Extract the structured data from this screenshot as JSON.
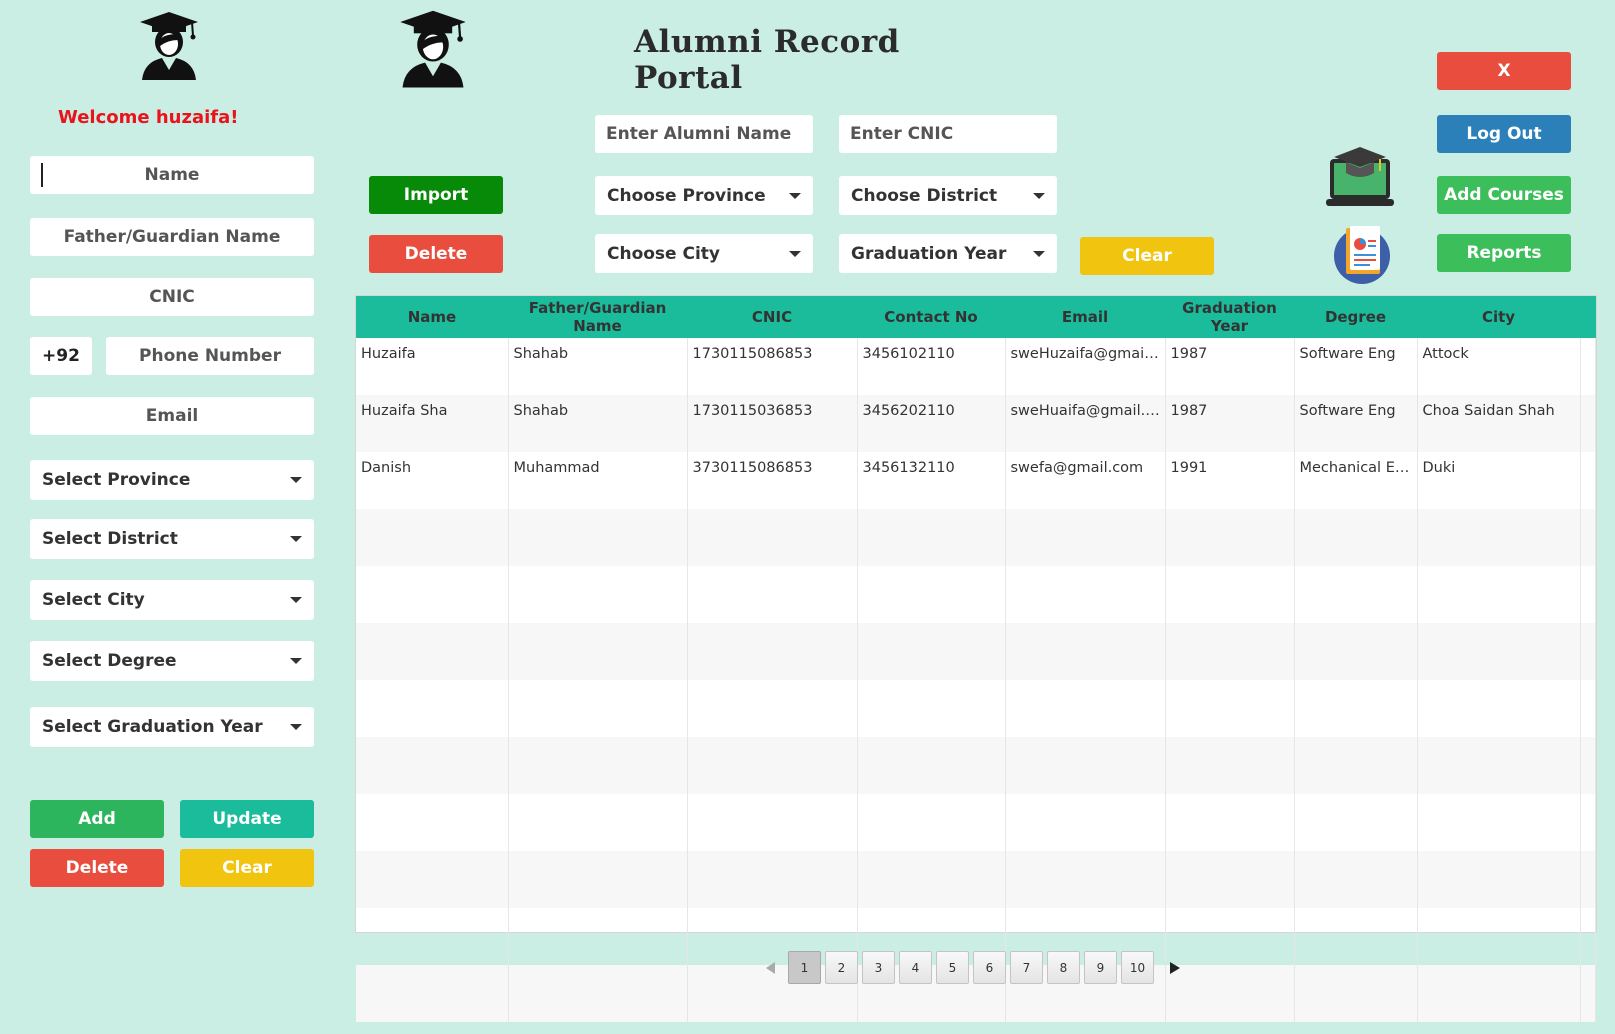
{
  "app": {
    "title": "Alumni Record Portal",
    "welcome": "Welcome huzaifa!"
  },
  "form": {
    "name_placeholder": "Name",
    "father_placeholder": "Father/Guardian Name",
    "cnic_placeholder": "CNIC",
    "phone_code": "+92",
    "phone_placeholder": "Phone Number",
    "email_placeholder": "Email",
    "province": "Select Province",
    "district": "Select District",
    "city": "Select City",
    "degree": "Select Degree",
    "grad_year": "Select Graduation Year",
    "add_label": "Add",
    "update_label": "Update",
    "delete_label": "Delete",
    "clear_label": "Clear"
  },
  "toolbar": {
    "import_label": "Import",
    "delete_label": "Delete",
    "search_name_placeholder": "Enter Alumni Name",
    "search_cnic_placeholder": "Enter CNIC",
    "province": "Choose Province",
    "district": "Choose District",
    "city": "Choose City",
    "grad_year": "Graduation Year",
    "clear_label": "Clear"
  },
  "side_actions": {
    "close_label": "X",
    "logout_label": "Log Out",
    "add_courses_label": "Add Courses",
    "reports_label": "Reports"
  },
  "table": {
    "headers": [
      "Name",
      "Father/Guardian Name",
      "CNIC",
      "Contact No",
      "Email",
      "Graduation Year",
      "Degree",
      "City"
    ],
    "rows": [
      [
        "Huzaifa",
        "Shahab",
        "1730115086853",
        "3456102110",
        "sweHuzaifa@gmail.com",
        "1987",
        "Software Eng",
        "Attock"
      ],
      [
        "Huzaifa Sha",
        "Shahab",
        "1730115036853",
        "3456202110",
        "sweHuaifa@gmail.com",
        "1987",
        "Software Eng",
        "Choa Saidan Shah"
      ],
      [
        "Danish",
        "Muhammad",
        "3730115086853",
        "3456132110",
        "swefa@gmail.com",
        "1991",
        "Mechanical Engineering",
        "Duki"
      ]
    ],
    "empty_rows": 9
  },
  "pagination": {
    "pages": [
      "1",
      "2",
      "3",
      "4",
      "5",
      "6",
      "7",
      "8",
      "9",
      "10"
    ],
    "current": "1"
  },
  "icons": {
    "logo_left": "graduate-icon",
    "logo_center": "graduate-icon",
    "courses": "laptop-graduation-cap-icon",
    "reports": "report-document-icon"
  },
  "colors": {
    "background": "#cbeee4",
    "header": "#1abc9c",
    "red": "#e84d3d",
    "yellow": "#f1c40f",
    "green": "#2db55d",
    "blue": "#2c80ba",
    "dark_green": "#078a07",
    "welcome_text": "#e8131b"
  }
}
